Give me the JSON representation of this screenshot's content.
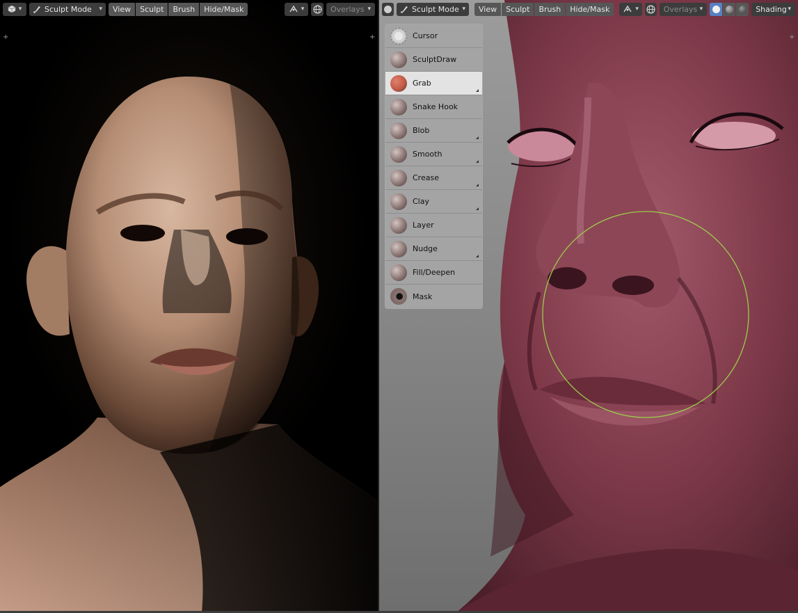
{
  "colors": {
    "header_button": "#565656",
    "active_tool": "#e3e3e3",
    "toolbar": "#a8a8a8",
    "brush_circle": "#9ccd4a",
    "skin_sculpt": "#7a3a48",
    "active_shading": "#5680c2"
  },
  "left_header": {
    "editor_icon": "cube-icon",
    "mode_icon": "brush-icon",
    "mode": "Sculpt Mode",
    "menus": [
      "View",
      "Sculpt",
      "Brush",
      "Hide/Mask"
    ],
    "gizmo_icon": "transform-icon",
    "overlays_icon": "globe-icon",
    "overlays": "Overlays"
  },
  "right_header": {
    "mode_icon": "brush-icon",
    "mode": "Sculpt Mode",
    "menus": [
      "View",
      "Sculpt",
      "Brush",
      "Hide/Mask"
    ],
    "gizmo_icon": "transform-icon",
    "overlays_icon": "globe-icon",
    "overlays": "Overlays",
    "shading": "Shading"
  },
  "toolbar": {
    "tools": [
      {
        "label": "Cursor",
        "icon": "cursor-icon",
        "color": "#d9d9d9",
        "active": false,
        "has_submenu": false
      },
      {
        "label": "SculptDraw",
        "icon": "sculpt-draw-icon",
        "color": "#8a7572",
        "active": false,
        "has_submenu": false
      },
      {
        "label": "Grab",
        "icon": "grab-icon",
        "color": "#c25a45",
        "active": true,
        "has_submenu": true
      },
      {
        "label": "Snake Hook",
        "icon": "snake-hook-icon",
        "color": "#8a7572",
        "active": false,
        "has_submenu": false
      },
      {
        "label": "Blob",
        "icon": "blob-icon",
        "color": "#8a7572",
        "active": false,
        "has_submenu": true
      },
      {
        "label": "Smooth",
        "icon": "smooth-icon",
        "color": "#8a7572",
        "active": false,
        "has_submenu": true
      },
      {
        "label": "Crease",
        "icon": "crease-icon",
        "color": "#8a7572",
        "active": false,
        "has_submenu": true
      },
      {
        "label": "Clay",
        "icon": "clay-icon",
        "color": "#8a7572",
        "active": false,
        "has_submenu": true
      },
      {
        "label": "Layer",
        "icon": "layer-icon",
        "color": "#8a7572",
        "active": false,
        "has_submenu": false
      },
      {
        "label": "Nudge",
        "icon": "nudge-icon",
        "color": "#8a7572",
        "active": false,
        "has_submenu": true
      },
      {
        "label": "Fill/Deepen",
        "icon": "fill-deepen-icon",
        "color": "#8a7572",
        "active": false,
        "has_submenu": false
      },
      {
        "label": "Mask",
        "icon": "mask-icon",
        "color": "#8a7572",
        "active": false,
        "has_submenu": false
      }
    ]
  }
}
